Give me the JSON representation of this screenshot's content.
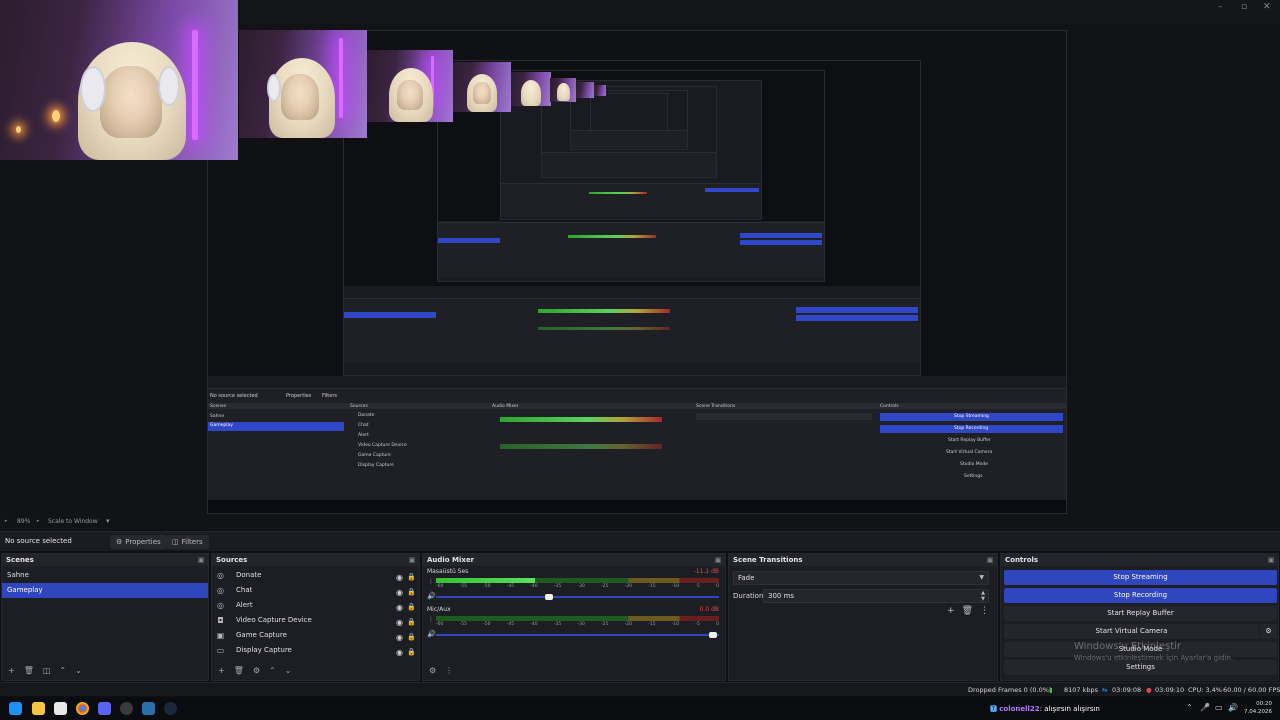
{
  "preview": {
    "nested_obs_labels": [
      "No source selected",
      "Properties",
      "Filters",
      "Scenes",
      "Sources",
      "Audio Mixer",
      "Scene Transitions",
      "Controls",
      "Stop Streaming",
      "Stop Recording",
      "Start Replay Buffer",
      "Start Virtual Camera",
      "Studio Mode",
      "Settings",
      "Sahne",
      "Gameplay",
      "Donate",
      "Chat",
      "Alert",
      "Video Capture Device",
      "Game Capture",
      "Display Capture"
    ]
  },
  "zoom": {
    "percent": "89%",
    "mode": "Scale to Window"
  },
  "context": {
    "no_source": "No source selected",
    "properties": "Properties",
    "filters": "Filters"
  },
  "scenes": {
    "title": "Scenes",
    "items": [
      {
        "label": "Sahne"
      },
      {
        "label": "Gameplay"
      }
    ],
    "selected_index": 1
  },
  "sources": {
    "title": "Sources",
    "items": [
      {
        "label": "Donate",
        "icon": "browser-icon"
      },
      {
        "label": "Chat",
        "icon": "browser-icon"
      },
      {
        "label": "Alert",
        "icon": "browser-icon"
      },
      {
        "label": "Video Capture Device",
        "icon": "camera-icon"
      },
      {
        "label": "Game Capture",
        "icon": "gamepad-icon"
      },
      {
        "label": "Display Capture",
        "icon": "monitor-icon"
      }
    ]
  },
  "mixer": {
    "title": "Audio Mixer",
    "ticks": [
      "-60",
      "-55",
      "-50",
      "-45",
      "-40",
      "-35",
      "-30",
      "-25",
      "-20",
      "-15",
      "-10",
      "-5",
      "0"
    ],
    "channels": [
      {
        "name": "Masaüstü Ses",
        "db": "-11.1 dB",
        "db_color": "#e04848",
        "level": 0.35,
        "volume": 0.4
      },
      {
        "name": "Mic/Aux",
        "db": "0.0 dB",
        "db_color": "#e04848",
        "level": 0.0,
        "volume": 0.98
      }
    ]
  },
  "transitions": {
    "title": "Scene Transitions",
    "selected": "Fade",
    "duration_label": "Duration",
    "duration_value": "300 ms"
  },
  "controls": {
    "title": "Controls",
    "stop_streaming": "Stop Streaming",
    "stop_recording": "Stop Recording",
    "start_replay": "Start Replay Buffer",
    "start_virtual": "Start Virtual Camera",
    "studio_mode": "Studio Mode",
    "settings": "Settings",
    "accent": "#2f46be"
  },
  "activation": {
    "line1": "Windows'u Etkinleştir",
    "line2": "Windows'u etkinleştirmek için Ayarlar'a gidin."
  },
  "status": {
    "dropped": "Dropped Frames 0 (0.0%)",
    "kbps": "8107 kbps",
    "stream_time": "03:09:08",
    "rec_time": "03:09:10",
    "cpu": "CPU: 3.4%",
    "fps": "60.00 / 60.00 FPS"
  },
  "taskbar": {
    "chat_user": "colonell22",
    "chat_msg": ": alışırsın alışırsın",
    "time": "00:20",
    "date": "7.04.2026"
  }
}
